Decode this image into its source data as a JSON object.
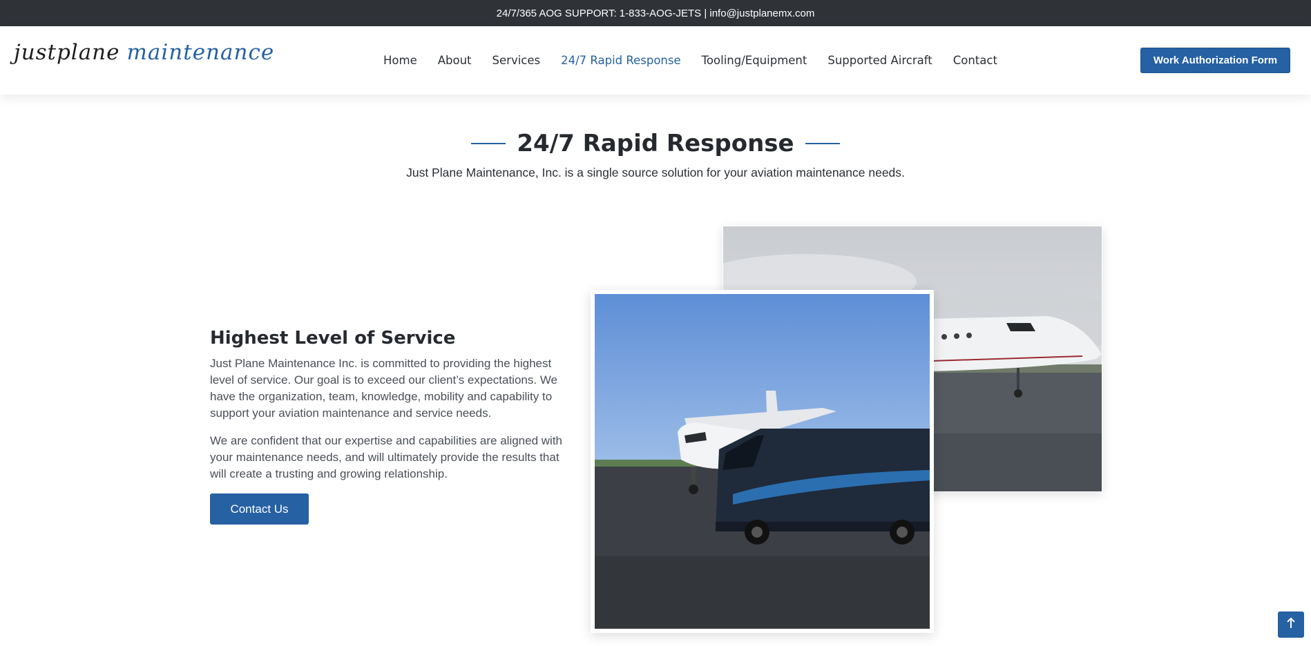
{
  "topbar": {
    "text": "24/7/365 AOG SUPPORT: 1-833-AOG-JETS | info@justplanemx.com"
  },
  "logo": {
    "part1": "justplane",
    "part2": "maintenance"
  },
  "nav": {
    "items": [
      {
        "label": "Home",
        "active": false
      },
      {
        "label": "About",
        "active": false
      },
      {
        "label": "Services",
        "active": false
      },
      {
        "label": "24/7 Rapid Response",
        "active": true
      },
      {
        "label": "Tooling/Equipment",
        "active": false
      },
      {
        "label": "Supported Aircraft",
        "active": false
      },
      {
        "label": "Contact",
        "active": false
      }
    ],
    "cta_label": "Work Authorization Form"
  },
  "hero": {
    "title": "24/7 Rapid Response",
    "subtitle": "Just Plane Maintenance, Inc. is a single source solution for your aviation maintenance needs."
  },
  "section": {
    "heading": "Highest Level of Service",
    "paragraph1": "Just Plane Maintenance Inc. is committed to providing the highest level of service. Our goal is to exceed our client’s expectations. We have the organization, team, knowledge, mobility and capability to support your aviation maintenance and service needs.",
    "paragraph2": "We are confident that our expertise and capabilities are aligned with your maintenance needs, and will ultimately provide the results that will create a trusting and growing relationship.",
    "button_label": "Contact Us"
  },
  "images": {
    "back_photo": "business jet on tarmac under cloudy sky",
    "front_photo": "jet and rapid response van on tarmac"
  },
  "icons": {
    "scroll_top": "arrow-up-icon"
  },
  "colors": {
    "accent": "#2561a3",
    "topbar": "#2f3338",
    "text": "#2b2f36"
  }
}
